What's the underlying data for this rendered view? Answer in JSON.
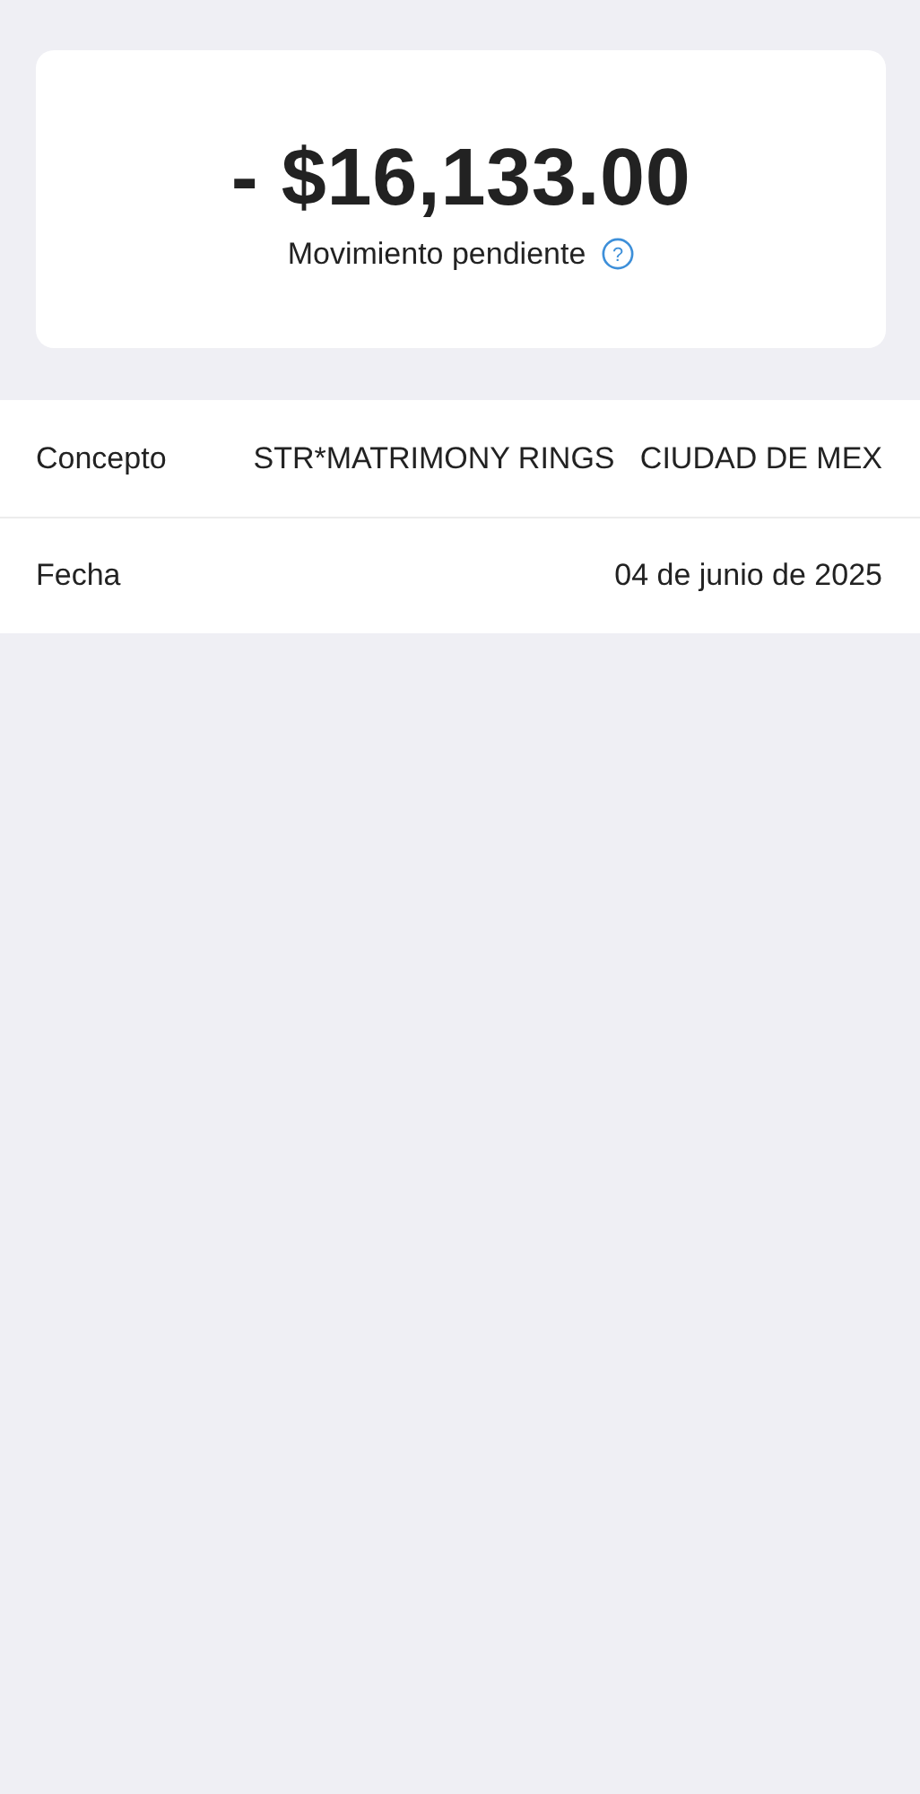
{
  "summary": {
    "amount": "- $16,133.00",
    "status": "Movimiento pendiente",
    "help_icon": "?"
  },
  "details": [
    {
      "label": "Concepto",
      "value": "STR*MATRIMONY RINGS   CIUDAD DE MEX"
    },
    {
      "label": "Fecha",
      "value": "04 de junio de 2025"
    }
  ]
}
